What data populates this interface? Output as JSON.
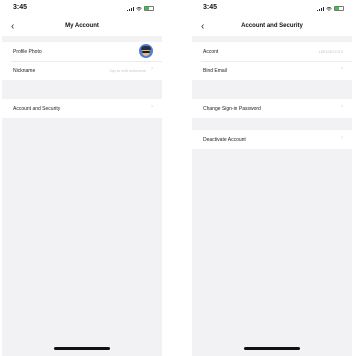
{
  "left_screen": {
    "time": "3:45",
    "title": "My Account",
    "profile_photo_label": "Profile Photo",
    "nickname_label": "Nickname",
    "nickname_placeholder": "Tap to edit nickname",
    "account_security_label": "Account and Security"
  },
  "right_screen": {
    "time": "3:45",
    "title": "Account and Security",
    "account_label": "Accont",
    "account_value": "18516621219",
    "bind_email_label": "Bind Email",
    "change_password_label": "Change Sign-in Password",
    "deactivate_label": "Deactivate Account"
  },
  "icons": {
    "back": "chevron-left-icon",
    "row_arrow": "chevron-right-icon",
    "signal": "signal-icon",
    "wifi": "wifi-icon",
    "battery": "battery-icon"
  },
  "colors": {
    "background": "#f2f2f4",
    "battery": "#3cc44a",
    "avatar": "#4f7fd6"
  }
}
